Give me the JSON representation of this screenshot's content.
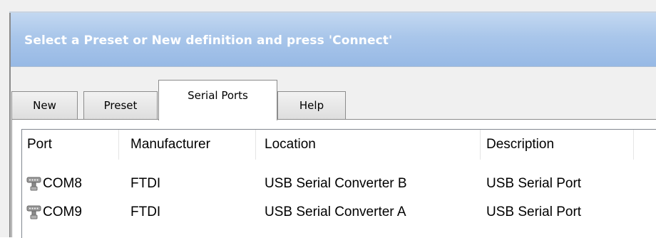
{
  "banner": {
    "text": "Select a Preset or New definition and press 'Connect'"
  },
  "tabs": [
    {
      "label": "New",
      "active": false
    },
    {
      "label": "Preset",
      "active": false
    },
    {
      "label": "Serial Ports",
      "active": true
    },
    {
      "label": "Help",
      "active": false
    }
  ],
  "ports_table": {
    "columns": [
      "Port",
      "Manufacturer",
      "Location",
      "Description"
    ],
    "rows": [
      {
        "port": "COM8",
        "manufacturer": "FTDI",
        "location": "USB Serial Converter B",
        "description": "USB Serial Port",
        "icon": "serial-port-icon"
      },
      {
        "port": "COM9",
        "manufacturer": "FTDI",
        "location": "USB Serial Converter A",
        "description": "USB Serial Port",
        "icon": "serial-port-icon"
      }
    ]
  }
}
